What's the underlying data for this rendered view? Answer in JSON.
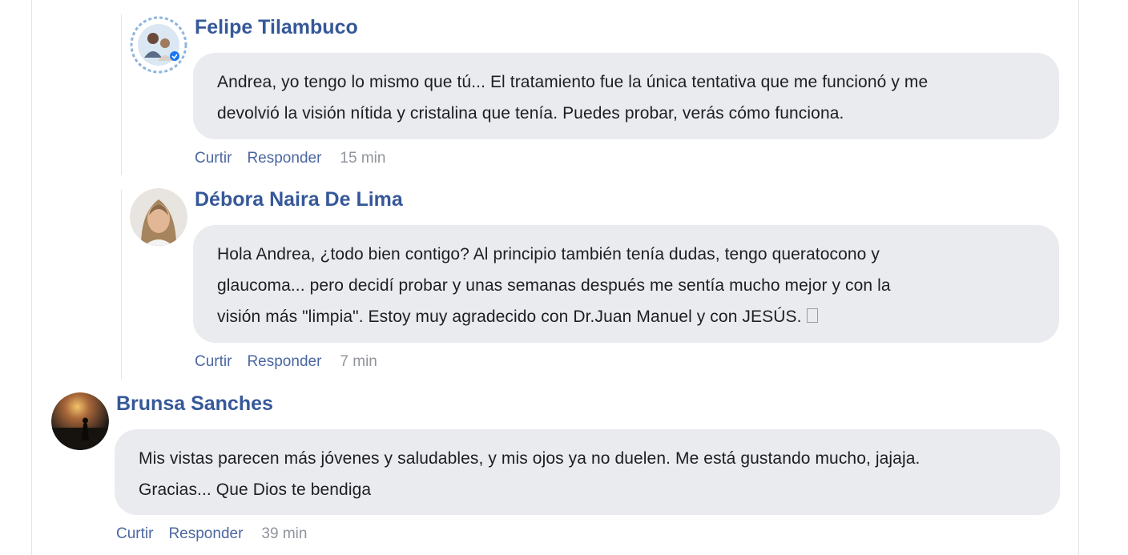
{
  "comments": [
    {
      "author": "Felipe Tilambuco",
      "avatar": "avatar-felipe",
      "text_line1": "Andrea, yo tengo lo mismo que tú... El tratamiento fue la única tentativa que me funcionó y me",
      "text_line2": "devolvió la visión nítida y cristalina que tenía. Puedes probar, verás cómo funciona.",
      "like_label": "Curtir",
      "reply_label": "Responder",
      "time": "15 min"
    },
    {
      "author": "Débora Naira De Lima",
      "avatar": "avatar-debora",
      "text_line1": "Hola Andrea, ¿todo bien contigo? Al principio también tenía dudas, tengo queratocono y",
      "text_line2": "glaucoma... pero decidí probar y unas semanas después me sentía mucho mejor y con la",
      "text_line3": "visión más \"limpia\". Estoy muy agradecido con Dr.Juan Manuel y con JESÚS.",
      "emoji_icon": "missing-glyph-icon",
      "like_label": "Curtir",
      "reply_label": "Responder",
      "time": "7 min"
    },
    {
      "author": "Brunsa Sanches",
      "avatar": "avatar-brunsa",
      "text_line1": "Mis vistas parecen más jóvenes y saludables, y mis ojos ya no duelen. Me está gustando mucho, jajaja.",
      "text_line2": "Gracias... Que Dios te bendiga",
      "like_label": "Curtir",
      "reply_label": "Responder",
      "time": "39 min"
    }
  ],
  "colors": {
    "author": "#365899",
    "link": "#4b67a1",
    "time": "#90949c",
    "bubble": "#eaebef",
    "text": "#1c1e21"
  }
}
